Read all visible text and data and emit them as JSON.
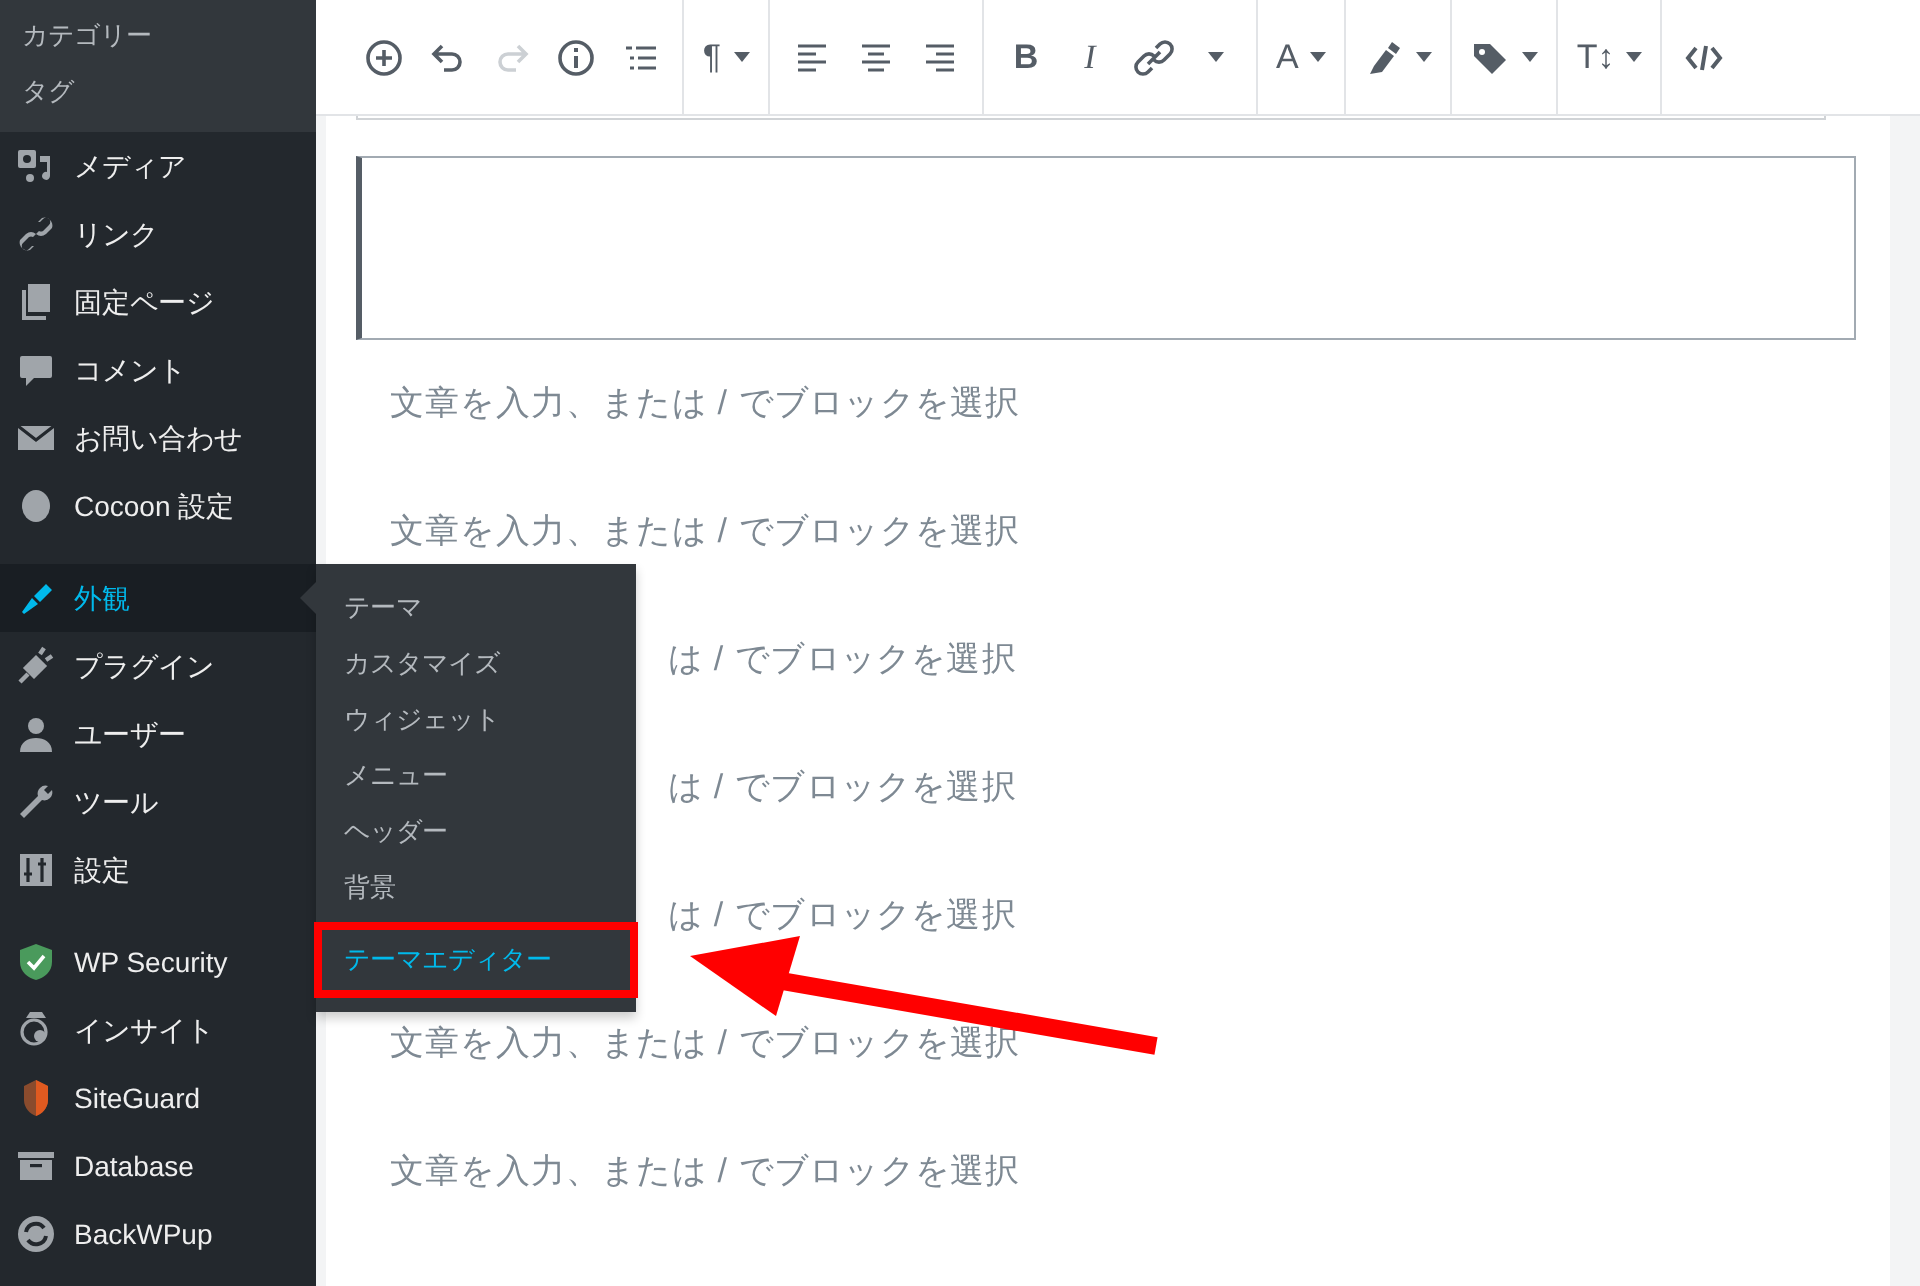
{
  "sidebar": {
    "submenu": [
      {
        "label": "カテゴリー"
      },
      {
        "label": "タグ"
      }
    ],
    "groups": [
      [
        {
          "label": "メディア",
          "selected": false
        },
        {
          "label": "リンク",
          "selected": false
        },
        {
          "label": "固定ページ",
          "selected": false
        },
        {
          "label": "コメント",
          "selected": false
        },
        {
          "label": "お問い合わせ",
          "selected": false
        },
        {
          "label": "Cocoon 設定",
          "selected": false
        }
      ],
      [
        {
          "label": "外観",
          "selected": true
        },
        {
          "label": "プラグイン",
          "selected": false
        },
        {
          "label": "ユーザー",
          "selected": false
        },
        {
          "label": "ツール",
          "selected": false
        },
        {
          "label": "設定",
          "selected": false
        }
      ],
      [
        {
          "label": "WP Security",
          "selected": false
        },
        {
          "label": "インサイト",
          "selected": false
        },
        {
          "label": "SiteGuard",
          "selected": false
        },
        {
          "label": "Database",
          "selected": false
        },
        {
          "label": "BackWPup",
          "selected": false
        }
      ]
    ]
  },
  "flyout": [
    {
      "label": "テーマ",
      "selected": false,
      "highlighted": false
    },
    {
      "label": "カスタマイズ",
      "selected": false,
      "highlighted": false
    },
    {
      "label": "ウィジェット",
      "selected": false,
      "highlighted": false
    },
    {
      "label": "メニュー",
      "selected": false,
      "highlighted": false
    },
    {
      "label": "ヘッダー",
      "selected": false,
      "highlighted": false
    },
    {
      "label": "背景",
      "selected": false,
      "highlighted": false
    },
    {
      "label": "テーマエディター",
      "selected": true,
      "highlighted": true
    }
  ],
  "toolbar": [
    [
      {
        "kind": "add",
        "disabled": false
      },
      {
        "kind": "undo",
        "disabled": false
      },
      {
        "kind": "redo",
        "disabled": true
      },
      {
        "kind": "info",
        "disabled": false
      },
      {
        "kind": "outline",
        "disabled": false
      }
    ],
    [
      {
        "kind": "text",
        "label": "¶",
        "dropdown": true
      }
    ],
    [
      {
        "kind": "align-left"
      },
      {
        "kind": "align-center"
      },
      {
        "kind": "align-right"
      }
    ],
    [
      {
        "kind": "bold",
        "label": "B"
      },
      {
        "kind": "italic",
        "label": "I"
      },
      {
        "kind": "link"
      },
      {
        "kind": "caret"
      }
    ],
    [
      {
        "kind": "text",
        "label": "A",
        "dropdown": true
      }
    ],
    [
      {
        "kind": "marker",
        "dropdown": true
      }
    ],
    [
      {
        "kind": "tag",
        "dropdown": true
      }
    ],
    [
      {
        "kind": "text",
        "label": "T↕",
        "dropdown": true
      }
    ],
    [
      {
        "kind": "code"
      }
    ]
  ],
  "editor": {
    "paragraphs": [
      {
        "kind": "full",
        "placeholder": "文章を入力、または / でブロックを選択"
      },
      {
        "kind": "full",
        "placeholder": "文章を入力、または / でブロックを選択"
      },
      {
        "kind": "partial",
        "placeholder": "は / でブロックを選択"
      },
      {
        "kind": "partial",
        "placeholder": "は / でブロックを選択"
      },
      {
        "kind": "partial",
        "placeholder": "は / でブロックを選択"
      },
      {
        "kind": "full",
        "placeholder": "文章を入力、または / でブロックを選択"
      },
      {
        "kind": "full",
        "placeholder": "文章を入力、または / でブロックを選択"
      }
    ]
  }
}
